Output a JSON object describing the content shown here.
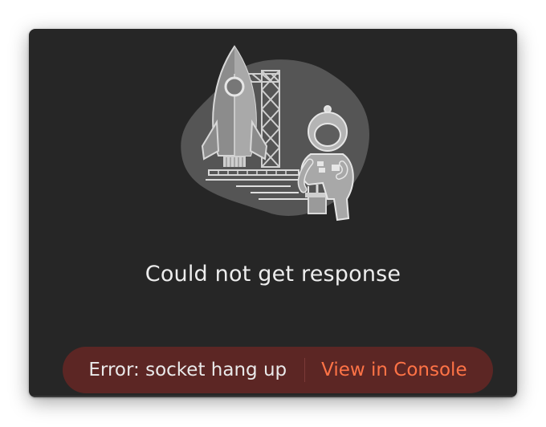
{
  "dialog": {
    "title": "Could not get response",
    "error_message": "Error: socket hang up",
    "console_link_label": "View in Console"
  },
  "colors": {
    "panel_background": "#262626",
    "error_bar_background": "#5c2624",
    "link_accent": "#ff7346"
  },
  "icons": {
    "illustration": "rocket-astronaut-illustration"
  }
}
